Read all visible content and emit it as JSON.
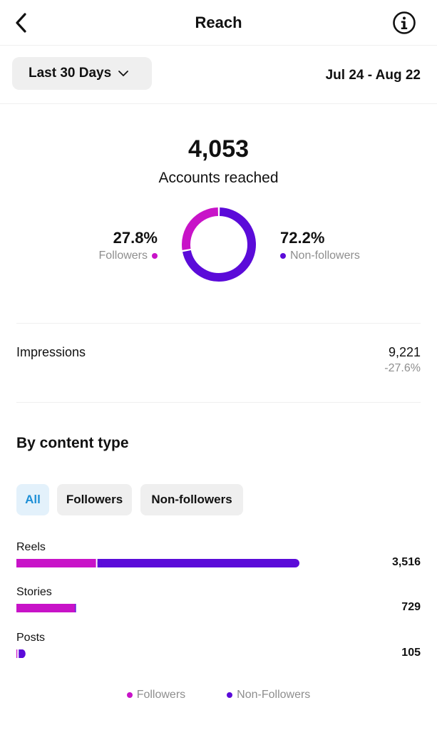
{
  "header": {
    "title": "Reach",
    "back_icon": "chevron-left-icon",
    "info_icon": "info-icon"
  },
  "range": {
    "label": "Last 30 Days",
    "dates": "Jul 24 - Aug 22"
  },
  "summary": {
    "total": "4,053",
    "label": "Accounts reached",
    "followers": {
      "pct": "27.8%",
      "label": "Followers",
      "fraction": 0.278
    },
    "non_followers": {
      "pct": "72.2%",
      "label": "Non-followers",
      "fraction": 0.722
    }
  },
  "impressions": {
    "label": "Impressions",
    "value": "9,221",
    "change": "-27.6%"
  },
  "content_type": {
    "title": "By content type",
    "chips": [
      "All",
      "Followers",
      "Non-followers"
    ],
    "selected_chip": "All",
    "rows": [
      {
        "label": "Reels",
        "value": "3,516",
        "total": 3516,
        "followers": 1000,
        "non_followers": 2516
      },
      {
        "label": "Stories",
        "value": "729",
        "total": 729,
        "followers": 729,
        "non_followers": 0
      },
      {
        "label": "Posts",
        "value": "105",
        "total": 105,
        "followers": 20,
        "non_followers": 85
      }
    ],
    "legend": [
      "Followers",
      "Non-Followers"
    ]
  },
  "colors": {
    "followers": "#c813c8",
    "non_followers": "#5b0bd9",
    "accent": "#1d8fd6"
  }
}
